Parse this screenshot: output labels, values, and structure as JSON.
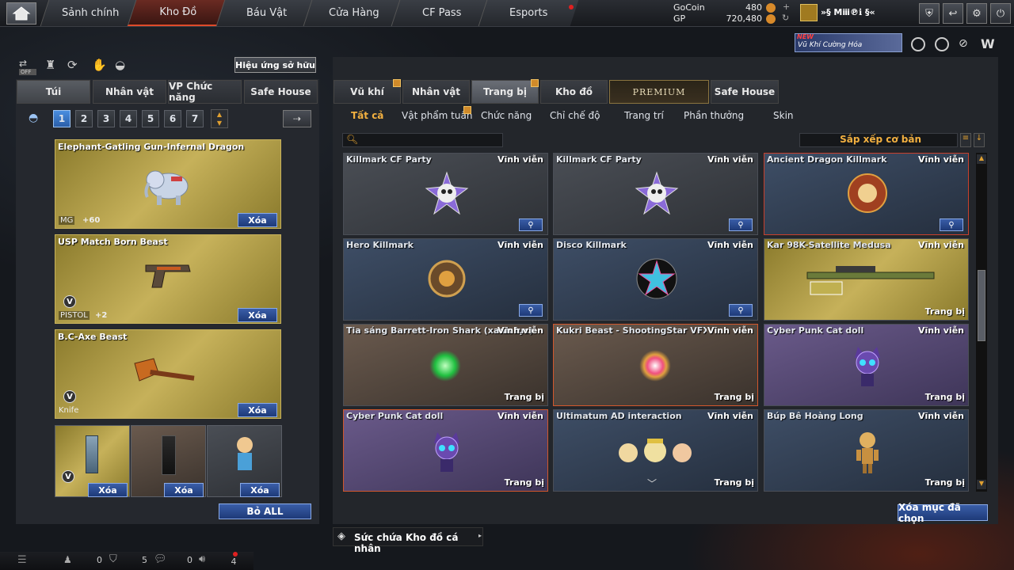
{
  "top_nav": {
    "tabs": [
      {
        "label": "Sảnh chính"
      },
      {
        "label": "Kho Đồ"
      },
      {
        "label": "Báu Vật"
      },
      {
        "label": "Cửa Hàng"
      },
      {
        "label": "CF Pass"
      },
      {
        "label": "Esports"
      }
    ],
    "active_tab": "Kho Đồ",
    "gocoin_label": "GoCoin",
    "gocoin_value": "480",
    "gp_label": "GP",
    "gp_value": "720,480",
    "username": "»§ Mⅲ℗ℹ §«"
  },
  "promo": {
    "badge": "NEW",
    "text": "Vũ Khí Cường Hóa"
  },
  "left": {
    "effect_toggle": "OFF",
    "effect_button": "Hiệu ứng sở hữu",
    "tabs": [
      "Túi",
      "Nhân vật",
      "VP Chức năng",
      "Safe House"
    ],
    "pages": [
      "1",
      "2",
      "3",
      "4",
      "5",
      "6",
      "7"
    ],
    "items": [
      {
        "name": "Elephant-Gatling Gun-Infernal Dragon",
        "type": "MG",
        "upgrade": "+60",
        "delete": "Xóa"
      },
      {
        "name": "USP Match Born Beast",
        "type": "PISTOL",
        "upgrade": "+2",
        "delete": "Xóa"
      },
      {
        "name": "B.C-Axe Beast",
        "type": "Knife",
        "delete": "Xóa"
      }
    ],
    "small_items": [
      {
        "delete": "Xóa"
      },
      {
        "delete": "Xóa"
      },
      {
        "delete": "Xóa"
      }
    ],
    "remove_all": "Bỏ ALL"
  },
  "right": {
    "tabs": [
      "Vũ khí",
      "Nhân vật",
      "Trang bị",
      "Kho đồ",
      "PREMIUM",
      "Safe House"
    ],
    "active_tab": "Trang bị",
    "subtabs": [
      "Tất cả",
      "Vật phẩm tuần",
      "Chức năng",
      "Chỉ chế độ",
      "Trang trí",
      "Phần thưởng",
      "Skin"
    ],
    "sort_label": "Sắp xếp cơ bản",
    "items": [
      {
        "name": "Killmark CF Party",
        "duration": "Vĩnh viễn"
      },
      {
        "name": "Killmark CF Party",
        "duration": "Vĩnh viễn"
      },
      {
        "name": "Ancient Dragon Killmark",
        "duration": "Vĩnh viễn"
      },
      {
        "name": "Hero Killmark",
        "duration": "Vĩnh viễn"
      },
      {
        "name": "Disco Killmark",
        "duration": "Vĩnh viễn"
      },
      {
        "name": "Kar 98K-Satellite Medusa",
        "duration": "Vĩnh viễn",
        "action": "Trang bị"
      },
      {
        "name": "Tia sáng Barrett-Iron Shark (xanh lục)",
        "duration": "Vĩnh viễn",
        "action": "Trang bị"
      },
      {
        "name": "Kukri Beast - ShootingStar VFX",
        "duration": "Vĩnh viễn",
        "action": "Trang bị"
      },
      {
        "name": "Cyber Punk Cat doll",
        "duration": "Vĩnh viễn",
        "action": "Trang bị"
      },
      {
        "name": "Cyber Punk Cat doll",
        "duration": "Vĩnh viễn",
        "action": "Trang bị"
      },
      {
        "name": "Ultimatum AD interaction",
        "duration": "Vĩnh viễn",
        "action": "Trang bị"
      },
      {
        "name": "Búp Bê Hoàng Long",
        "duration": "Vĩnh viễn",
        "action": "Trang bị"
      }
    ],
    "delete_selected": "Xóa mục đã chọn",
    "capacity_label": "Sức chứa Kho đồ cá nhân"
  },
  "bottom": {
    "count1": "0",
    "count2": "5",
    "count3": "0",
    "count4": "4"
  }
}
